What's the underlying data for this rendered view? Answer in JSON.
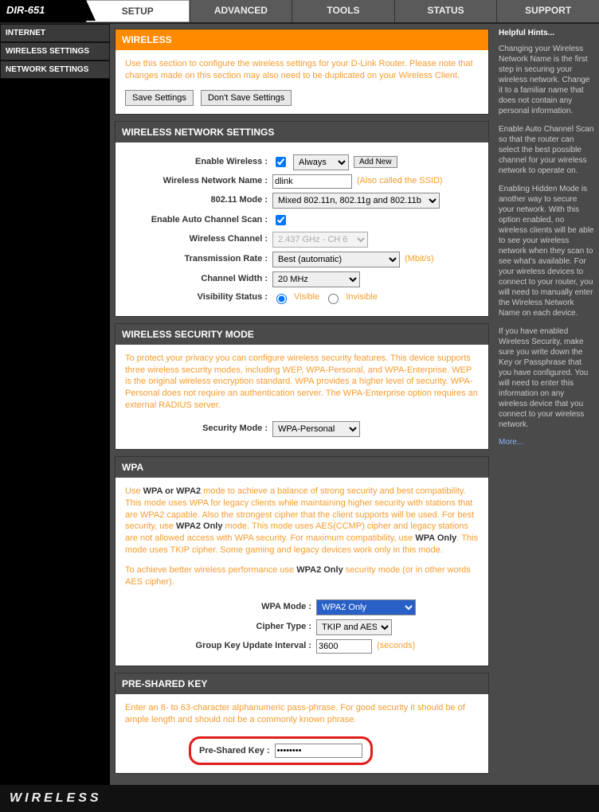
{
  "brand": "DIR-651",
  "topnav": {
    "setup": "SETUP",
    "advanced": "ADVANCED",
    "tools": "TOOLS",
    "status": "STATUS",
    "support": "SUPPORT"
  },
  "sidebar": {
    "internet": "INTERNET",
    "wireless": "WIRELESS SETTINGS",
    "network": "NETWORK SETTINGS"
  },
  "help": {
    "title": "Helpful Hints...",
    "p1": "Changing your Wireless Network Name is the first step in securing your wireless network. Change it to a familiar name that does not contain any personal information.",
    "p2": "Enable Auto Channel Scan so that the router can select the best possible channel for your wireless network to operate on.",
    "p3": "Enabling Hidden Mode is another way to secure your network. With this option enabled, no wireless clients will be able to see your wireless network when they scan to see what's available. For your wireless devices to connect to your router, you will need to manually enter the Wireless Network Name on each device.",
    "p4": "If you have enabled Wireless Security, make sure you write down the Key or Passphrase that you have configured. You will need to enter this information on any wireless device that you connect to your wireless network.",
    "more": "More..."
  },
  "intro": {
    "title": "WIRELESS",
    "text": "Use this section to configure the wireless settings for your D-Link Router. Please note that changes made on this section may also need to be duplicated on your Wireless Client.",
    "save": "Save Settings",
    "dontsave": "Don't Save Settings"
  },
  "netset": {
    "title": "WIRELESS NETWORK SETTINGS",
    "enable_label": "Enable Wireless :",
    "always": "Always",
    "addnew": "Add New",
    "ssid_label": "Wireless Network Name :",
    "ssid_value": "dlink",
    "ssid_note": "(Also called the SSID)",
    "mode_label": "802.11 Mode :",
    "mode_value": "Mixed 802.11n, 802.11g and 802.11b",
    "autochan_label": "Enable Auto Channel Scan :",
    "chan_label": "Wireless Channel :",
    "chan_value": "2.437 GHz - CH 6",
    "rate_label": "Transmission Rate :",
    "rate_value": "Best (automatic)",
    "rate_unit": "(Mbit/s)",
    "width_label": "Channel Width :",
    "width_value": "20 MHz",
    "vis_label": "Visibility Status :",
    "vis_visible": "Visible",
    "vis_invisible": "Invisible"
  },
  "secmode": {
    "title": "WIRELESS SECURITY MODE",
    "text": "To protect your privacy you can configure wireless security features. This device supports three wireless security modes, including WEP, WPA-Personal, and WPA-Enterprise. WEP is the original wireless encryption standard. WPA provides a higher level of security. WPA-Personal does not require an authentication server. The WPA-Enterprise option requires an external RADIUS server.",
    "label": "Security Mode :",
    "value": "WPA-Personal"
  },
  "wpa": {
    "title": "WPA",
    "p1a": "Use ",
    "p1b": "WPA or WPA2",
    "p1c": " mode to achieve a balance of strong security and best compatibility. This mode uses WPA for legacy clients while maintaining higher security with stations that are WPA2 capable. Also the strongest cipher that the client supports will be used. For best security, use ",
    "p1d": "WPA2 Only",
    "p1e": " mode. This mode uses AES(CCMP) cipher and legacy stations are not allowed access with WPA security. For maximum compatibility, use ",
    "p1f": "WPA Only",
    "p1g": ". This mode uses TKIP cipher. Some gaming and legacy devices work only in this mode.",
    "p2a": "To achieve better wireless performance use ",
    "p2b": "WPA2 Only",
    "p2c": " security mode (or in other words AES cipher).",
    "mode_label": "WPA Mode :",
    "mode_value": "WPA2 Only",
    "cipher_label": "Cipher Type :",
    "cipher_value": "TKIP and AES",
    "gkui_label": "Group Key Update Interval :",
    "gkui_value": "3600",
    "gkui_unit": "(seconds)"
  },
  "psk": {
    "title": "PRE-SHARED KEY",
    "text": "Enter an 8- to 63-character alphanumeric pass-phrase. For good security it should be of ample length and should not be a commonly known phrase.",
    "label": "Pre-Shared Key :",
    "value": "••••••••"
  },
  "footer": "WIRELESS"
}
